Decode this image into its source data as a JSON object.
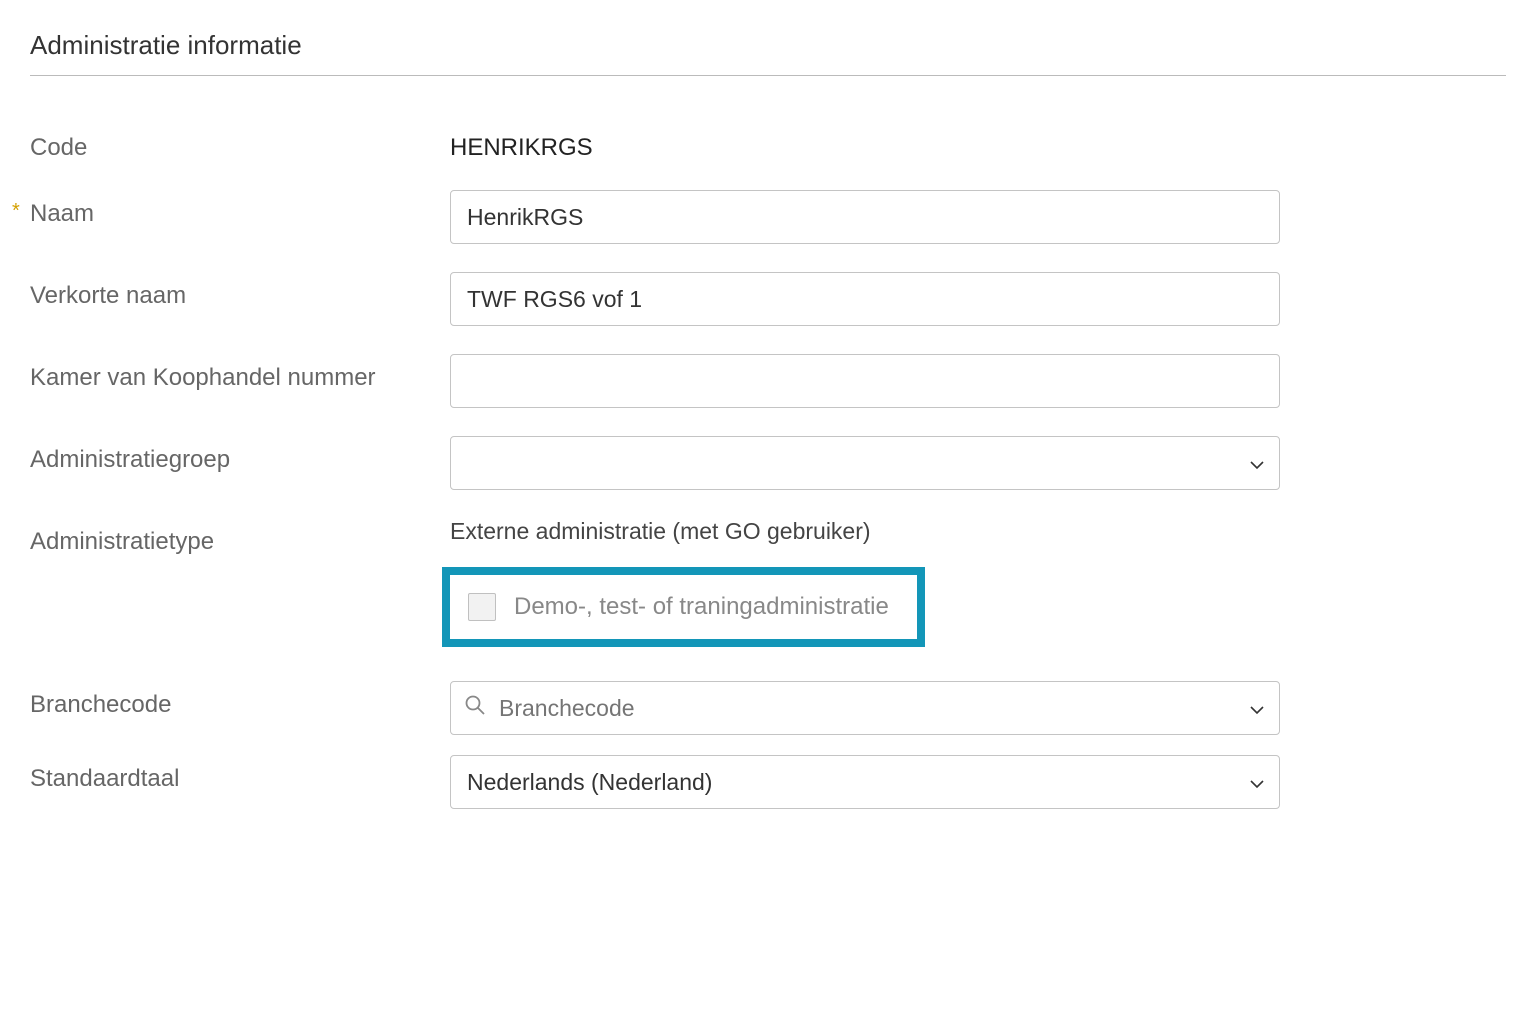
{
  "section": {
    "title": "Administratie informatie"
  },
  "fields": {
    "code": {
      "label": "Code",
      "value": "HENRIKRGS"
    },
    "name": {
      "label": "Naam",
      "value": "HenrikRGS",
      "required_mark": "*"
    },
    "short_name": {
      "label": "Verkorte naam",
      "value": "TWF RGS6 vof 1"
    },
    "kvk": {
      "label": "Kamer van Koophandel nummer",
      "value": ""
    },
    "admin_group": {
      "label": "Administratiegroep",
      "value": ""
    },
    "admin_type": {
      "label": "Administratietype",
      "value": "Externe administratie (met GO gebruiker)"
    },
    "demo_checkbox": {
      "label": "Demo-, test- of traningadministratie"
    },
    "branch_code": {
      "label": "Branchecode",
      "placeholder": "Branchecode",
      "value": ""
    },
    "default_lang": {
      "label": "Standaardtaal",
      "value": "Nederlands (Nederland)"
    }
  }
}
